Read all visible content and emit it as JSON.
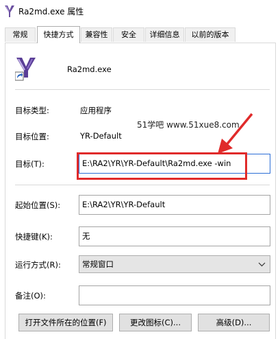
{
  "window": {
    "title": "Ra2md.exe 属性"
  },
  "tabs": [
    "常规",
    "快捷方式",
    "兼容性",
    "安全",
    "详细信息",
    "以前的版本"
  ],
  "file": {
    "name": "Ra2md.exe"
  },
  "fields": {
    "target_type": {
      "label": "目标类型:",
      "value": "应用程序"
    },
    "target_location": {
      "label": "目标位置:",
      "value": "YR-Default"
    },
    "target": {
      "label": "目标(T):",
      "value": "E:\\RA2\\YR\\YR-Default\\Ra2md.exe -win"
    },
    "start_in": {
      "label": "起始位置(S):",
      "value": "E:\\RA2\\YR\\YR-Default"
    },
    "shortcut_key": {
      "label": "快捷键(K):",
      "value": "无"
    },
    "run": {
      "label": "运行方式(R):",
      "value": "常规窗口"
    },
    "comment": {
      "label": "备注(O):",
      "value": ""
    }
  },
  "buttons": {
    "open_location": "打开文件所在的位置(F)",
    "change_icon": "更改图标(C)...",
    "advanced": "高级(D)..."
  },
  "watermark": "51学吧 www.51xue8.com",
  "colors": {
    "callout": "#e02a2a",
    "focus": "#2b6dd6"
  },
  "icons": {
    "app": "ra2-ypsilon-icon",
    "shortcut_overlay": "shortcut-arrow-icon",
    "dropdown": "chevron-down-icon"
  }
}
